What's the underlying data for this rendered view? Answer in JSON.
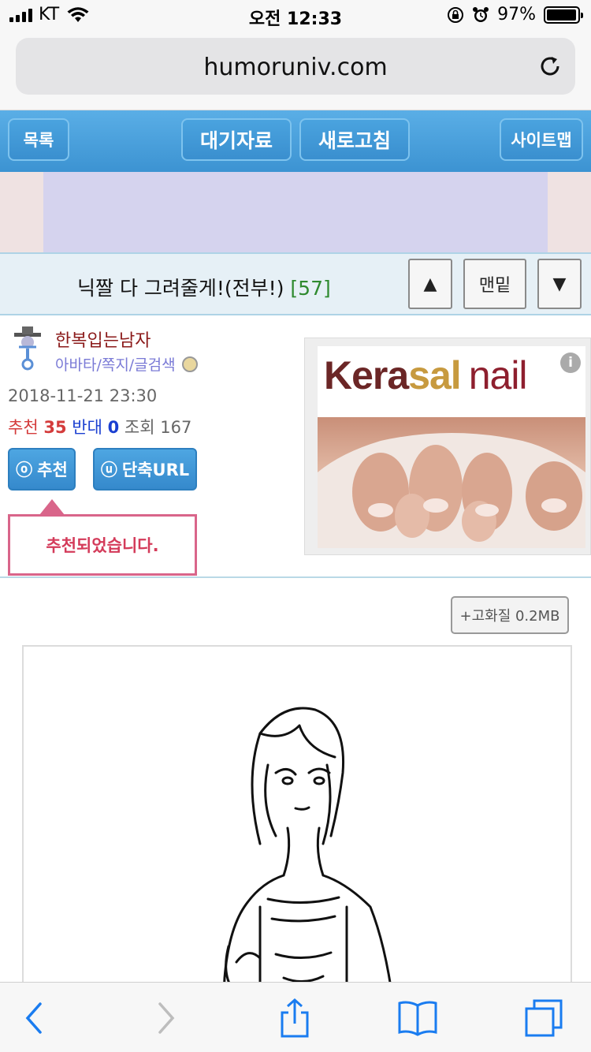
{
  "status_bar": {
    "carrier": "KT",
    "time": "오전 12:33",
    "battery": "97%",
    "battery_level": 0.97
  },
  "browser": {
    "url": "humoruniv.com"
  },
  "site_nav": {
    "list_label": "목록",
    "pending_label": "대기자료",
    "refresh_label": "새로고침",
    "sitemap_label": "사이트맵"
  },
  "post": {
    "title": "닉짤 다 그려줄게!(전부!)",
    "comment_count": "[57]",
    "up_label": "▲",
    "bottom_label": "맨밑",
    "down_label": "▼"
  },
  "author": {
    "name": "한복입는남자",
    "links": "아바타/쪽지/글검색"
  },
  "meta": {
    "date": "2018-11-21 23:30",
    "recommend_label": "추천",
    "recommend_count": "35",
    "oppose_label": "반대",
    "oppose_count": "0",
    "views_label": "조회",
    "views_count": "167"
  },
  "actions": {
    "recommend_glyph": "ⓞ",
    "recommend_label": "추천",
    "short_url_glyph": "ⓤ",
    "short_url_label": "단축URL",
    "tooltip": "추천되었습니다."
  },
  "ad": {
    "brand_part1": "Kera",
    "brand_part2": "sal",
    "brand_part3": "nail",
    "info_glyph": "i"
  },
  "content": {
    "hq_button": "+고화질 0.2MB"
  },
  "colors": {
    "nav_blue": "#3c93d2",
    "recommend_red": "#d43b3b",
    "oppose_blue": "#1a3fd1",
    "title_count_green": "#2f8a2f",
    "tooltip_pink": "#d9658a"
  },
  "icons": {
    "back": "chevron-left-icon",
    "forward": "chevron-right-icon",
    "share": "share-icon",
    "bookmarks": "book-icon",
    "tabs": "tabs-icon",
    "reload": "reload-icon"
  }
}
